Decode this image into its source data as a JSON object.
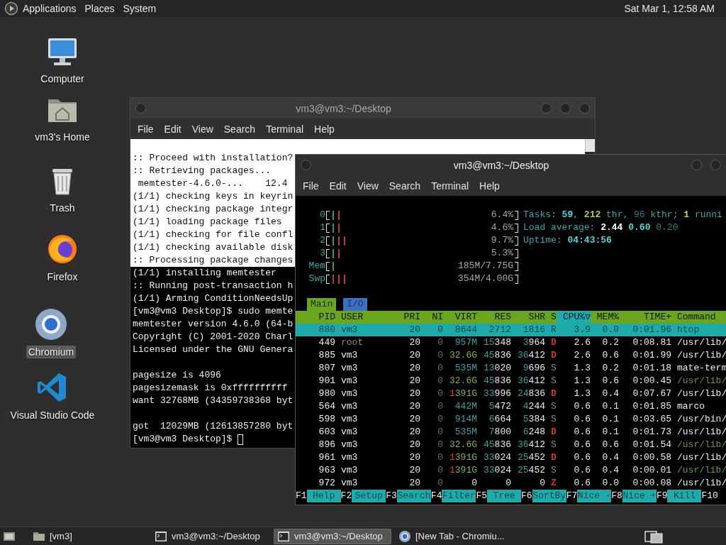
{
  "top_panel": {
    "menus": [
      "Applications",
      "Places",
      "System"
    ],
    "clock": "Sat Mar 1, 12:58 AM"
  },
  "desktop_icons": [
    {
      "label": "Computer",
      "kind": "computer",
      "selected": false
    },
    {
      "label": "vm3's Home",
      "kind": "home",
      "selected": false
    },
    {
      "label": "Trash",
      "kind": "trash",
      "selected": false
    },
    {
      "label": "Firefox",
      "kind": "firefox",
      "selected": false
    },
    {
      "label": "Chromium",
      "kind": "chromium",
      "selected": true
    },
    {
      "label": "Visual Studio Code",
      "kind": "vscode",
      "selected": false
    }
  ],
  "back_terminal": {
    "title": "vm3@vm3:~/Desktop",
    "menu": [
      "File",
      "Edit",
      "View",
      "Search",
      "Terminal",
      "Help"
    ],
    "cursor": true,
    "lines": [
      {
        "kind": "light",
        "text": ":: Proceed with installation?"
      },
      {
        "kind": "light",
        "text": ":: Retrieving packages..."
      },
      {
        "kind": "light",
        "text": " memtester-4.6.0-...    12.4"
      },
      {
        "kind": "light",
        "text": "(1/1) checking keys in keyrin"
      },
      {
        "kind": "light",
        "text": "(1/1) checking package integr"
      },
      {
        "kind": "light",
        "text": "(1/1) loading package files"
      },
      {
        "kind": "light",
        "text": "(1/1) checking for file confl"
      },
      {
        "kind": "light",
        "text": "(1/1) checking available disk"
      },
      {
        "kind": "light",
        "text": ":: Processing package changes"
      },
      {
        "kind": "dark",
        "text": "(1/1) installing memtester"
      },
      {
        "kind": "dark",
        "text": ":: Running post-transaction h"
      },
      {
        "kind": "dark",
        "text": "(1/1) Arming ConditionNeedsUp"
      },
      {
        "kind": "dark",
        "text": "[vm3@vm3 Desktop]$ sudo memte"
      },
      {
        "kind": "dark",
        "text": "memtester version 4.6.0 (64-b"
      },
      {
        "kind": "dark",
        "text": "Copyright (C) 2001-2020 Charl"
      },
      {
        "kind": "dark",
        "text": "Licensed under the GNU Genera"
      },
      {
        "kind": "blank"
      },
      {
        "kind": "dark",
        "text": "pagesize is 4096"
      },
      {
        "kind": "dark",
        "text": "pagesizemask is 0xffffffffff"
      },
      {
        "kind": "dark",
        "text": "want 32768MB (34359738368 byt"
      },
      {
        "kind": "blank"
      },
      {
        "kind": "dark",
        "text": "got  12029MB (12613857280 byt"
      },
      {
        "kind": "dark",
        "text": "[vm3@vm3 Desktop]$ "
      }
    ]
  },
  "htop_window": {
    "title": "vm3@vm3:~/Desktop",
    "menu": [
      "File",
      "Edit",
      "View",
      "Search",
      "Terminal",
      "Help"
    ],
    "meters": [
      {
        "label": "0",
        "kind": "cpu",
        "level": 0.064,
        "reading": "6.4%"
      },
      {
        "label": "1",
        "kind": "cpu",
        "level": 0.046,
        "reading": "4.6%"
      },
      {
        "label": "2",
        "kind": "cpu",
        "level": 0.097,
        "reading": "9.7%"
      },
      {
        "label": "3",
        "kind": "cpu",
        "level": 0.053,
        "reading": "5.3%"
      },
      {
        "label": "Mem",
        "kind": "mem",
        "level": 0.024,
        "reading": "185M/7.75G"
      },
      {
        "label": "Swp",
        "kind": "swap",
        "level": 0.089,
        "reading": "354M/4.00G"
      }
    ],
    "info": [
      {
        "segments": [
          {
            "text": "Tasks: ",
            "kind": "label"
          },
          {
            "text": "59",
            "kind": "value"
          },
          {
            "text": ", ",
            "kind": "label"
          },
          {
            "text": "212",
            "kind": "threads"
          },
          {
            "text": " thr, ",
            "kind": "label"
          },
          {
            "text": "96",
            "kind": "dim"
          },
          {
            "text": " kthr; ",
            "kind": "label"
          },
          {
            "text": "1",
            "kind": "running"
          },
          {
            "text": " runni",
            "kind": "label"
          }
        ]
      },
      {
        "segments": [
          {
            "text": "Load average: ",
            "kind": "label"
          },
          {
            "text": "2.44",
            "kind": "bright"
          },
          {
            "text": " 0.60",
            "kind": "value"
          },
          {
            "text": " 0.20",
            "kind": "dim"
          }
        ]
      },
      {
        "segments": [
          {
            "text": "Uptime: ",
            "kind": "label"
          },
          {
            "text": "04:43:56",
            "kind": "value"
          }
        ]
      }
    ],
    "tabs": [
      {
        "label": "Main",
        "selected": true
      },
      {
        "label": "I/O",
        "selected": false
      }
    ],
    "columns": [
      {
        "label": "PID",
        "sorted": false
      },
      {
        "label": "USER",
        "sorted": false
      },
      {
        "label": "PRI",
        "sorted": false
      },
      {
        "label": "NI",
        "sorted": false
      },
      {
        "label": "VIRT",
        "sorted": false
      },
      {
        "label": "RES",
        "sorted": false
      },
      {
        "label": "SHR",
        "sorted": false
      },
      {
        "label": "S",
        "sorted": false
      },
      {
        "label": "CPU%▽",
        "sorted": true
      },
      {
        "label": "MEM%",
        "sorted": false
      },
      {
        "label": "TIME+",
        "sorted": false
      },
      {
        "label": "Command",
        "sorted": false
      }
    ],
    "rows": [
      {
        "pid": "880",
        "user": "vm3",
        "pri": "20",
        "ni": "0",
        "virt": "8644",
        "res": "2712",
        "shr": "1816",
        "state": "R",
        "cpu": "3.9",
        "mem": "0.0",
        "time": "0:01.96",
        "command": "htop",
        "selected": true,
        "thread": false,
        "user_dimmed": false
      },
      {
        "pid": "449",
        "user": "root",
        "pri": "20",
        "ni": "0",
        "virt": "957M",
        "res": "15348",
        "shr": "3964",
        "state": "D",
        "cpu": "2.6",
        "mem": "0.2",
        "time": "0:08.81",
        "command": "/usr/lib/",
        "selected": false,
        "thread": false,
        "user_dimmed": true
      },
      {
        "pid": "885",
        "user": "vm3",
        "pri": "20",
        "ni": "0",
        "virt": "32.6G",
        "res": "45836",
        "shr": "36412",
        "state": "D",
        "cpu": "2.6",
        "mem": "0.6",
        "time": "0:01.99",
        "command": "/usr/lib/",
        "selected": false,
        "thread": false,
        "user_dimmed": false
      },
      {
        "pid": "807",
        "user": "vm3",
        "pri": "20",
        "ni": "0",
        "virt": "535M",
        "res": "13020",
        "shr": "9696",
        "state": "S",
        "cpu": "1.3",
        "mem": "0.2",
        "time": "0:01.18",
        "command": "mate-term",
        "selected": false,
        "thread": false,
        "user_dimmed": false
      },
      {
        "pid": "901",
        "user": "vm3",
        "pri": "20",
        "ni": "0",
        "virt": "32.6G",
        "res": "45836",
        "shr": "36412",
        "state": "S",
        "cpu": "1.3",
        "mem": "0.6",
        "time": "0:00.45",
        "command": "/usr/lib/",
        "selected": false,
        "thread": true,
        "user_dimmed": false
      },
      {
        "pid": "980",
        "user": "vm3",
        "pri": "20",
        "ni": "0",
        "virt": "1391G",
        "res": "33996",
        "shr": "24836",
        "state": "D",
        "cpu": "1.3",
        "mem": "0.4",
        "time": "0:07.67",
        "command": "/usr/lib/",
        "selected": false,
        "thread": false,
        "user_dimmed": false
      },
      {
        "pid": "564",
        "user": "vm3",
        "pri": "20",
        "ni": "0",
        "virt": "442M",
        "res": "5472",
        "shr": "4244",
        "state": "S",
        "cpu": "0.6",
        "mem": "0.1",
        "time": "0:01.85",
        "command": "marco",
        "selected": false,
        "thread": false,
        "user_dimmed": false
      },
      {
        "pid": "598",
        "user": "vm3",
        "pri": "20",
        "ni": "0",
        "virt": "914M",
        "res": "6664",
        "shr": "5384",
        "state": "S",
        "cpu": "0.6",
        "mem": "0.1",
        "time": "0:03.65",
        "command": "/usr/bin/",
        "selected": false,
        "thread": false,
        "user_dimmed": false
      },
      {
        "pid": "603",
        "user": "vm3",
        "pri": "20",
        "ni": "0",
        "virt": "535M",
        "res": "7800",
        "shr": "6248",
        "state": "D",
        "cpu": "0.6",
        "mem": "0.1",
        "time": "0:01.73",
        "command": "/usr/lib/",
        "selected": false,
        "thread": false,
        "user_dimmed": false
      },
      {
        "pid": "896",
        "user": "vm3",
        "pri": "20",
        "ni": "0",
        "virt": "32.6G",
        "res": "45836",
        "shr": "36412",
        "state": "S",
        "cpu": "0.6",
        "mem": "0.6",
        "time": "0:01.54",
        "command": "/usr/lib/",
        "selected": false,
        "thread": true,
        "user_dimmed": false
      },
      {
        "pid": "961",
        "user": "vm3",
        "pri": "20",
        "ni": "0",
        "virt": "1391G",
        "res": "33024",
        "shr": "25452",
        "state": "D",
        "cpu": "0.6",
        "mem": "0.4",
        "time": "0:00.58",
        "command": "/usr/lib/",
        "selected": false,
        "thread": false,
        "user_dimmed": false
      },
      {
        "pid": "963",
        "user": "vm3",
        "pri": "20",
        "ni": "0",
        "virt": "1391G",
        "res": "33024",
        "shr": "25452",
        "state": "S",
        "cpu": "0.6",
        "mem": "0.4",
        "time": "0:00.01",
        "command": "/usr/lib/",
        "selected": false,
        "thread": true,
        "user_dimmed": false
      },
      {
        "pid": "972",
        "user": "vm3",
        "pri": "20",
        "ni": "0",
        "virt": "0",
        "res": "0",
        "shr": "0",
        "state": "Z",
        "cpu": "0.6",
        "mem": "0.0",
        "time": "0:00.08",
        "command": "/usr/lib/",
        "selected": false,
        "thread": false,
        "user_dimmed": false
      }
    ],
    "function_keys": [
      {
        "key": "F1",
        "label": "Help"
      },
      {
        "key": "F2",
        "label": "Setup"
      },
      {
        "key": "F3",
        "label": "Search"
      },
      {
        "key": "F4",
        "label": "Filter"
      },
      {
        "key": "F5",
        "label": "Tree"
      },
      {
        "key": "F6",
        "label": "SortBy"
      },
      {
        "key": "F7",
        "label": "Nice -"
      },
      {
        "key": "F8",
        "label": "Nice +"
      },
      {
        "key": "F9",
        "label": "Kill"
      },
      {
        "key": "F10"
      }
    ]
  },
  "taskbar": {
    "items": [
      {
        "label": "[vm3]",
        "kind": "folder",
        "selected": false
      },
      {
        "label": "vm3@vm3:~/Desktop",
        "kind": "terminal",
        "selected": false
      },
      {
        "label": "vm3@vm3:~/Desktop",
        "kind": "terminal",
        "selected": true
      },
      {
        "label": "[New Tab - Chromiu...",
        "kind": "browser",
        "selected": false
      }
    ]
  }
}
